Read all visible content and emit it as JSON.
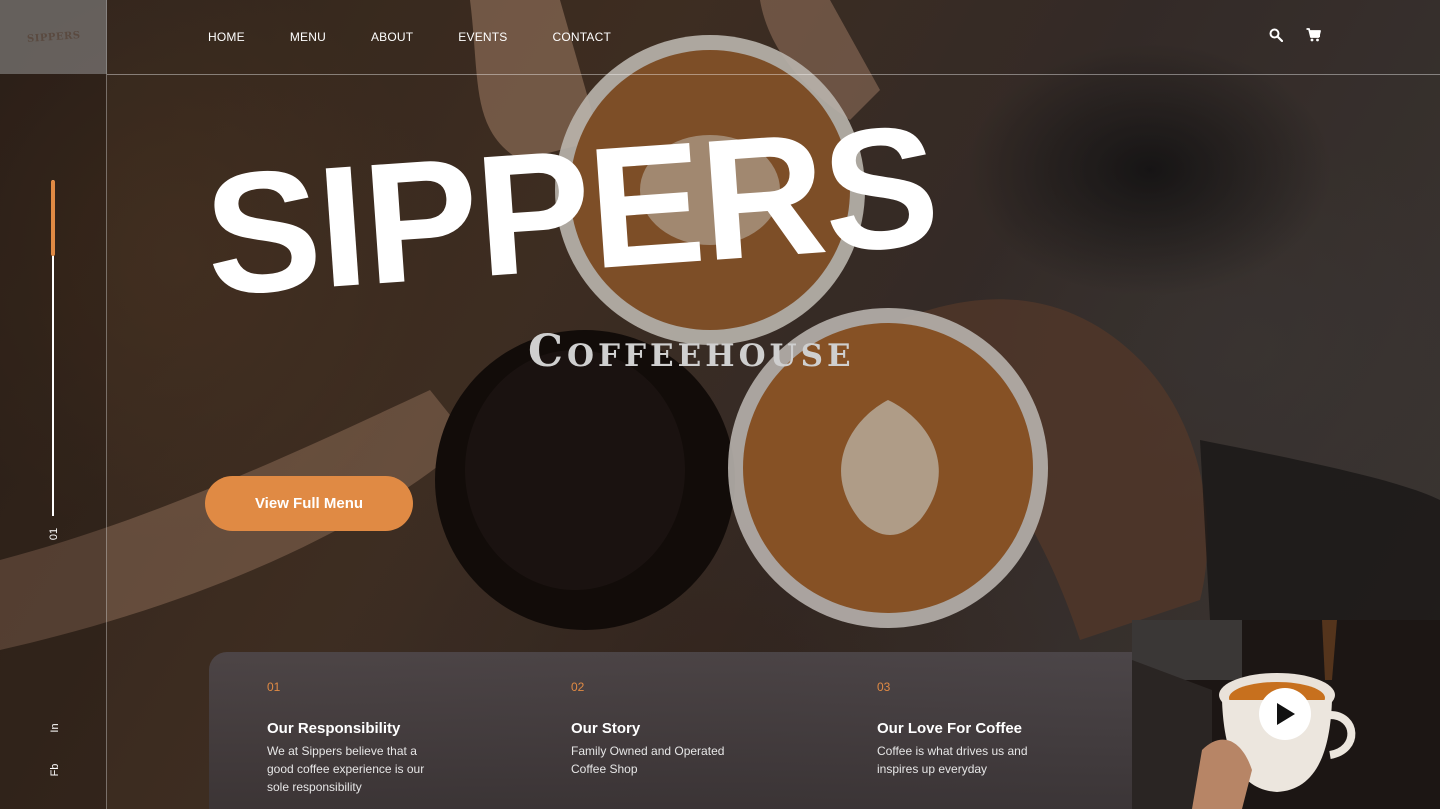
{
  "brand": {
    "logo_text": "SIPPERS"
  },
  "nav": {
    "links": [
      "HOME",
      "MENU",
      "ABOUT",
      "EVENTS",
      "CONTACT"
    ],
    "icons": [
      "search-icon",
      "cart-icon"
    ]
  },
  "hero": {
    "title": "SIPPERS",
    "subtitle": "Coffeehouse",
    "cta_label": "View Full Menu",
    "slide_number": "01"
  },
  "social": {
    "instagram": "In",
    "facebook": "Fb"
  },
  "features": [
    {
      "num": "01",
      "title": "Our Responsibility",
      "desc": "We at Sippers believe that a good coffee experience is our sole responsibility"
    },
    {
      "num": "02",
      "title": "Our Story",
      "desc": "Family Owned and Operated Coffee Shop"
    },
    {
      "num": "03",
      "title": "Our Love For Coffee",
      "desc": "Coffee is what drives us and inspires up everyday"
    }
  ],
  "colors": {
    "accent": "#e08a44"
  },
  "video": {
    "icon": "play-icon"
  }
}
